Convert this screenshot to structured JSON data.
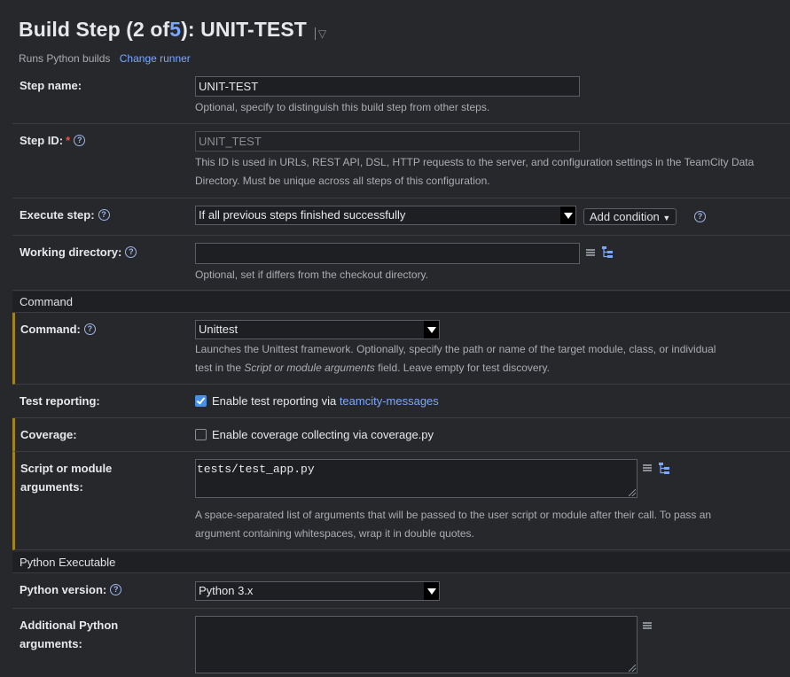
{
  "header": {
    "title_prefix": "Build Step (2 of ",
    "title_index": "5",
    "title_suffix": "): UNIT-TEST",
    "menu_caret": "▽",
    "runner_desc": "Runs Python builds",
    "change_runner": "Change runner"
  },
  "step_name": {
    "label": "Step name:",
    "value": "UNIT-TEST",
    "note": "Optional, specify to distinguish this build step from other steps."
  },
  "step_id": {
    "label": "Step ID:",
    "required_mark": "*",
    "value": "UNIT_TEST",
    "note_line1": "This ID is used in URLs, REST API, DSL, HTTP requests to the server, and configuration settings in the TeamCity Data",
    "note_line2": "Directory. Must be unique across all steps of this configuration."
  },
  "execute_step": {
    "label": "Execute step:",
    "selected": "If all previous steps finished successfully",
    "add_condition": "Add condition"
  },
  "working_directory": {
    "label": "Working directory:",
    "value": "",
    "note": "Optional, set if differs from the checkout directory."
  },
  "section_command": "Command",
  "command": {
    "label": "Command:",
    "selected": "Unittest",
    "note_line1": "Launches the Unittest framework. Optionally, specify the path or name of the target module, class, or individual",
    "note_line2_pre": "test in the ",
    "note_line2_italic": "Script or module arguments",
    "note_line2_post": " field. Leave empty for test discovery."
  },
  "test_reporting": {
    "label": "Test reporting:",
    "checked": true,
    "text": "Enable test reporting via ",
    "link": "teamcity-messages"
  },
  "coverage": {
    "label": "Coverage:",
    "checked": false,
    "text": "Enable coverage collecting via coverage.py"
  },
  "script_args": {
    "label_line1": "Script or module",
    "label_line2": "arguments:",
    "value": "tests/test_app.py",
    "note_line1": "A space-separated list of arguments that will be passed to the user script or module after their call. To pass an",
    "note_line2": "argument containing whitespaces, wrap it in double quotes."
  },
  "section_python": "Python Executable",
  "python_version": {
    "label": "Python version:",
    "selected": "Python 3.x"
  },
  "additional_args": {
    "label_line1": "Additional Python",
    "label_line2": "arguments:",
    "value": ""
  },
  "colors": {
    "background": "#27282c",
    "link": "#7aa7ff",
    "marker": "#a0841f",
    "checkbox": "#4a8fe7",
    "required": "#e5534b"
  }
}
